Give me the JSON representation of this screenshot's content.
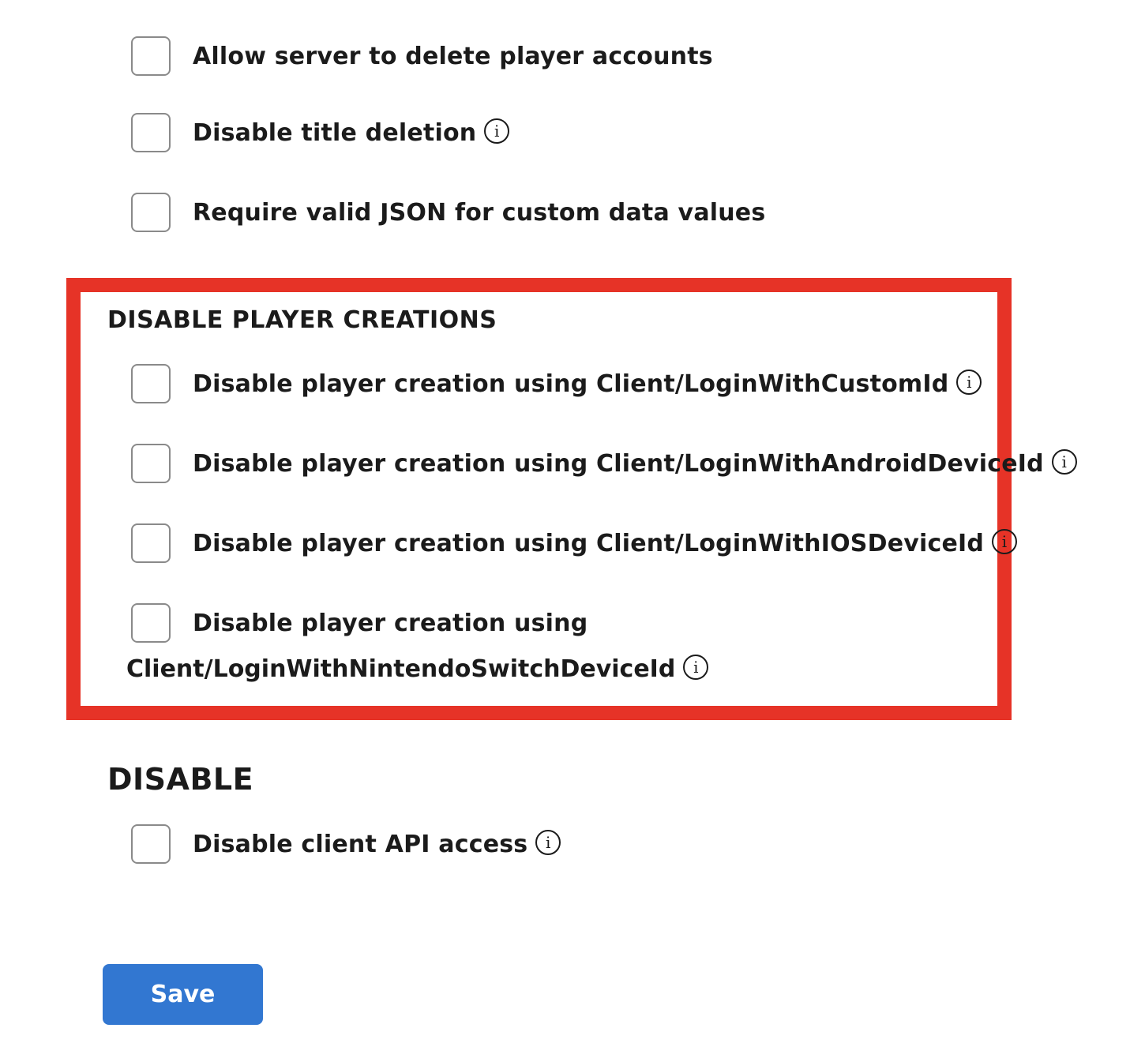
{
  "general_options": [
    {
      "label": "Allow server to delete player accounts",
      "checked": false,
      "has_info": false
    },
    {
      "label": "Disable title deletion",
      "checked": false,
      "has_info": true
    },
    {
      "label": "Require valid JSON for custom data values",
      "checked": false,
      "has_info": false
    }
  ],
  "player_creations": {
    "heading": "DISABLE PLAYER CREATIONS",
    "options": [
      {
        "label": "Disable player creation using Client/LoginWithCustomId",
        "checked": false
      },
      {
        "label": "Disable player creation using Client/LoginWithAndroidDeviceId",
        "checked": false
      },
      {
        "label": "Disable player creation using Client/LoginWithIOSDeviceId",
        "checked": false
      },
      {
        "label_line1": "Disable player creation using",
        "label_line2": "Client/LoginWithNintendoSwitchDeviceId",
        "checked": false
      }
    ],
    "highlight_color": "#e63327"
  },
  "disable_section": {
    "heading": "DISABLE",
    "options": [
      {
        "label": "Disable client API access",
        "checked": false
      }
    ]
  },
  "info_icon_glyph": "i",
  "save_button": {
    "label": "Save",
    "color": "#3277d1"
  }
}
